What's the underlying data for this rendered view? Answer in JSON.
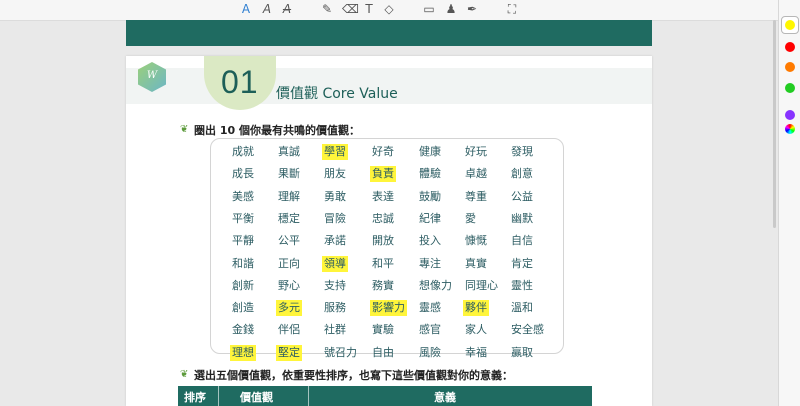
{
  "toolbar": {
    "icons": [
      "text-highlight-icon",
      "text-color-icon",
      "text-strikethrough-icon",
      "pen-icon",
      "eraser-icon",
      "text-tool-icon",
      "shape-icon",
      "comment-icon",
      "stamp-icon",
      "signature-icon",
      "fullscreen-icon"
    ],
    "glyphs": {
      "highlight": "A",
      "color": "A",
      "strike": "A",
      "pen": "✎",
      "eraser": "⌫",
      "text": "T",
      "shape": "◇",
      "comment": "▭",
      "stamp": "♟",
      "sign": "✒",
      "fullscreen": "⛶"
    }
  },
  "palette": {
    "selected": "#fff700",
    "colors": [
      "#ff0000",
      "#ff7a00",
      "#22cc22",
      "#8833ff",
      "rainbow"
    ]
  },
  "page": {
    "logo_letter": "W",
    "section_number": "01",
    "section_title": "價值觀 Core Value",
    "prompt1": "圈出 10 個你最有共鳴的價值觀：",
    "prompt2": "選出五個價值觀，依重要性排序，也寫下這些價值觀對你的意義：",
    "table_headers": [
      "排序",
      "價值觀",
      "意義"
    ]
  },
  "values_grid": [
    [
      "成就",
      "真誠",
      "學習",
      "好奇",
      "健康",
      "好玩",
      "發現"
    ],
    [
      "成長",
      "果斷",
      "朋友",
      "負責",
      "體驗",
      "卓越",
      "創意"
    ],
    [
      "美感",
      "理解",
      "勇敢",
      "表達",
      "鼓勵",
      "尊重",
      "公益"
    ],
    [
      "平衡",
      "穩定",
      "冒險",
      "忠誠",
      "紀律",
      "愛",
      "幽默"
    ],
    [
      "平靜",
      "公平",
      "承諾",
      "開放",
      "投入",
      "慷慨",
      "自信"
    ],
    [
      "和諧",
      "正向",
      "領導",
      "和平",
      "專注",
      "真實",
      "肯定"
    ],
    [
      "創新",
      "野心",
      "支持",
      "務實",
      "想像力",
      "同理心",
      "靈性"
    ],
    [
      "創造",
      "多元",
      "服務",
      "影響力",
      "靈感",
      "夥伴",
      "溫和"
    ],
    [
      "金錢",
      "伴侶",
      "社群",
      "實驗",
      "感官",
      "家人",
      "安全感"
    ],
    [
      "理想",
      "堅定",
      "號召力",
      "自由",
      "風險",
      "幸福",
      "贏取"
    ]
  ],
  "highlighted": [
    "學習",
    "負責",
    "領導",
    "多元",
    "影響力",
    "夥伴",
    "理想",
    "堅定"
  ]
}
